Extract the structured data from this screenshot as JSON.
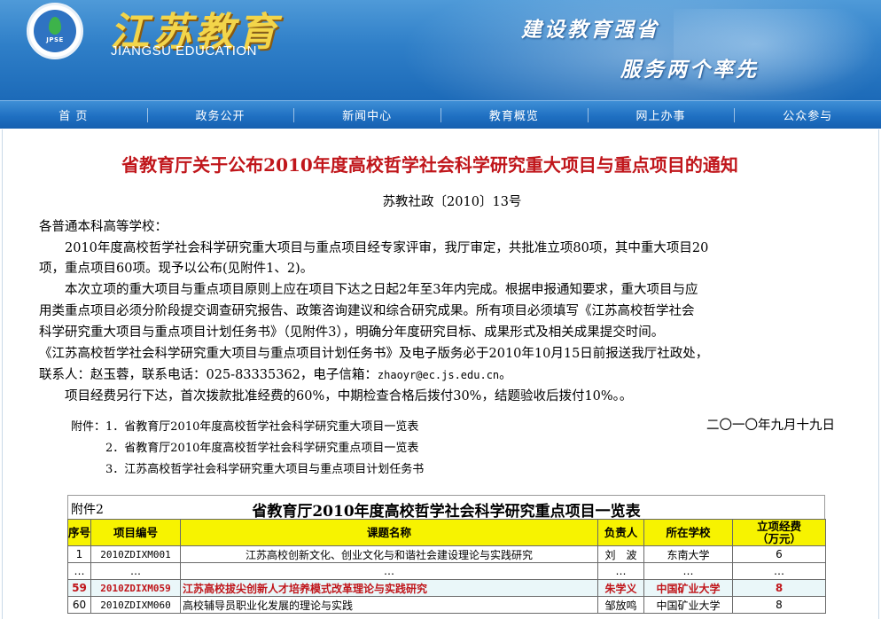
{
  "header": {
    "logo_text": "JPSE",
    "title_cn": "江苏教育",
    "title_en": "JIANGSU EDUCATION",
    "slogan_1": "建设教育强省",
    "slogan_2": "服务两个率先"
  },
  "nav": {
    "items": [
      {
        "label": "首 页"
      },
      {
        "label": "政务公开"
      },
      {
        "label": "新闻中心"
      },
      {
        "label": "教育概览"
      },
      {
        "label": "网上办事"
      },
      {
        "label": "公众参与"
      }
    ]
  },
  "article": {
    "title": "省教育厅关于公布2010年度高校哲学社会科学研究重大项目与重点项目的通知",
    "doc_no": "苏教社政〔2010〕13号",
    "salutation": "各普通本科高等学校：",
    "p1_line1": "　　2010年度高校哲学社会科学研究重大项目与重点项目经专家评审，我厅审定，共批准立项80项，其中重大项目20",
    "p1_line2": "项，重点项目60项。现予以公布(见附件1、2)。",
    "p2_line1": "　　本次立项的重大项目与重点项目原则上应在项目下达之日起2年至3年内完成。根据申报通知要求，重大项目与应",
    "p2_line2": "用类重点项目必须分阶段提交调查研究报告、政策咨询建议和综合研究成果。所有项目必须填写《江苏高校哲学社会",
    "p2_line3": "科学研究重大项目与重点项目计划任务书》（见附件3），明确分年度研究目标、成果形式及相关成果提交时间。",
    "p2_line4": "《江苏高校哲学社会科学研究重大项目与重点项目计划任务书》及电子版务必于2010年10月15日前报送我厅社政处，",
    "p2_line5_a": "联系人：赵玉蓉，联系电话：025-83335362，电子信箱：",
    "p2_email": "zhaoyr@ec.js.edu.cn",
    "p2_line5_b": "。",
    "p3": "　　项目经费另行下达，首次拨款批准经费的60%，中期检查合格后拨付30%，结题验收后拨付10%。。",
    "attachments": [
      "附件：1．省教育厅2010年度高校哲学社会科学研究重大项目一览表",
      "　　　2．省教育厅2010年度高校哲学社会科学研究重点项目一览表",
      "　　　3．江苏高校哲学社会科学研究重大项目与重点项目计划任务书"
    ],
    "date": "二〇一〇年九月十九日"
  },
  "table": {
    "label": "附件2",
    "caption": "省教育厅2010年度高校哲学社会科学研究重点项目一览表",
    "headers": {
      "no": "序号",
      "code": "项目编号",
      "topic": "课题名称",
      "leader": "负责人",
      "school": "所在学校",
      "fund_1": "立项经费",
      "fund_2": "（万元）"
    },
    "rows": [
      {
        "no": "1",
        "code": "2010ZDIXM001",
        "topic": "江苏高校创新文化、创业文化与和谐社会建设理论与实践研究",
        "leader": "刘　波",
        "school": "东南大学",
        "fund": "6"
      },
      {
        "no": "…",
        "code": "…",
        "topic": "…",
        "leader": "…",
        "school": "…",
        "fund": "…"
      },
      {
        "no": "59",
        "code": "2010ZDIXM059",
        "topic": "江苏高校拔尖创新人才培养模式改革理论与实践研究",
        "leader": "朱学义",
        "school": "中国矿业大学",
        "fund": "8"
      },
      {
        "no": "60",
        "code": "2010ZDIXM060",
        "topic": "高校辅导员职业化发展的理论与实践",
        "leader": "邹放鸣",
        "school": "中国矿业大学",
        "fund": "8"
      }
    ]
  }
}
